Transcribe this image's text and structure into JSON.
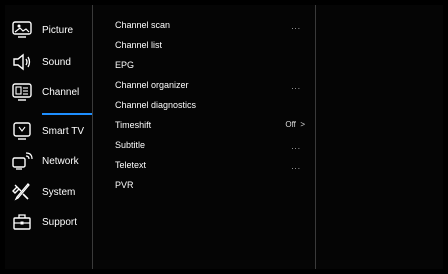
{
  "sidebar": {
    "items": [
      {
        "label": "Picture",
        "icon": "picture-icon"
      },
      {
        "label": "Sound",
        "icon": "sound-icon"
      },
      {
        "label": "Channel",
        "icon": "channel-icon",
        "selected": true
      },
      {
        "label": "Smart TV",
        "icon": "smart-tv-icon"
      },
      {
        "label": "Network",
        "icon": "network-icon"
      },
      {
        "label": "System",
        "icon": "system-icon"
      },
      {
        "label": "Support",
        "icon": "support-icon"
      }
    ]
  },
  "menu": {
    "items": [
      {
        "label": "Channel scan",
        "value": "",
        "has_more": true
      },
      {
        "label": "Channel list",
        "value": "",
        "has_more": false
      },
      {
        "label": "EPG",
        "value": "",
        "has_more": false
      },
      {
        "label": "Channel organizer",
        "value": "",
        "has_more": true
      },
      {
        "label": "Channel diagnostics",
        "value": "",
        "has_more": false
      },
      {
        "label": "Timeshift",
        "value": "Off  >",
        "has_more": false
      },
      {
        "label": "Subtitle",
        "value": "",
        "has_more": true
      },
      {
        "label": "Teletext",
        "value": "",
        "has_more": true
      },
      {
        "label": "PVR",
        "value": "",
        "has_more": false
      }
    ],
    "more_glyph": "...",
    "accent_color": "#1e8fff"
  }
}
